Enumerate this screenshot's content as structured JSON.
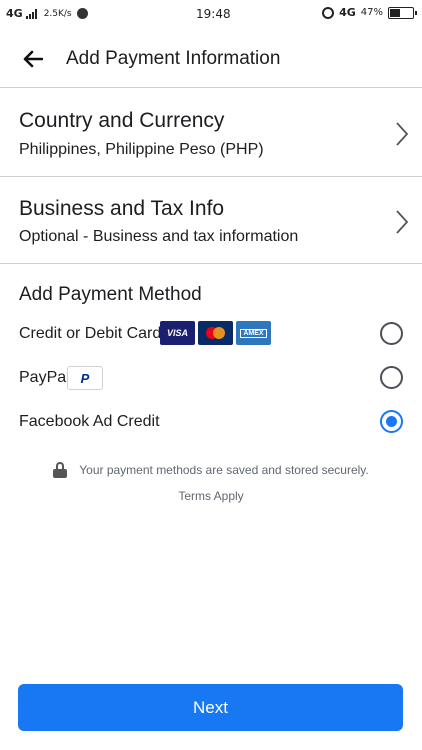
{
  "status_bar": {
    "network": "4G",
    "speed": "2.5K/s",
    "time": "19:48",
    "network_right": "4G",
    "battery_pct": "47%",
    "battery_level": 0.47
  },
  "header": {
    "title": "Add Payment Information"
  },
  "country": {
    "title": "Country and Currency",
    "value": "Philippines, Philippine Peso (PHP)"
  },
  "business": {
    "title": "Business and Tax Info",
    "value": "Optional - Business and tax information"
  },
  "payment": {
    "section_title": "Add Payment Method",
    "methods": [
      {
        "label": "Credit or Debit Card",
        "selected": false,
        "logos": [
          "VISA",
          "Mastercard",
          "AMEX"
        ]
      },
      {
        "label": "PayPal",
        "selected": false,
        "logos": [
          "PayPal"
        ]
      },
      {
        "label": "Facebook Ad Credit",
        "selected": true
      }
    ]
  },
  "secure": {
    "message": "Your payment methods are saved and stored securely.",
    "terms": "Terms Apply"
  },
  "next_label": "Next",
  "colors": {
    "accent": "#1877f2"
  }
}
